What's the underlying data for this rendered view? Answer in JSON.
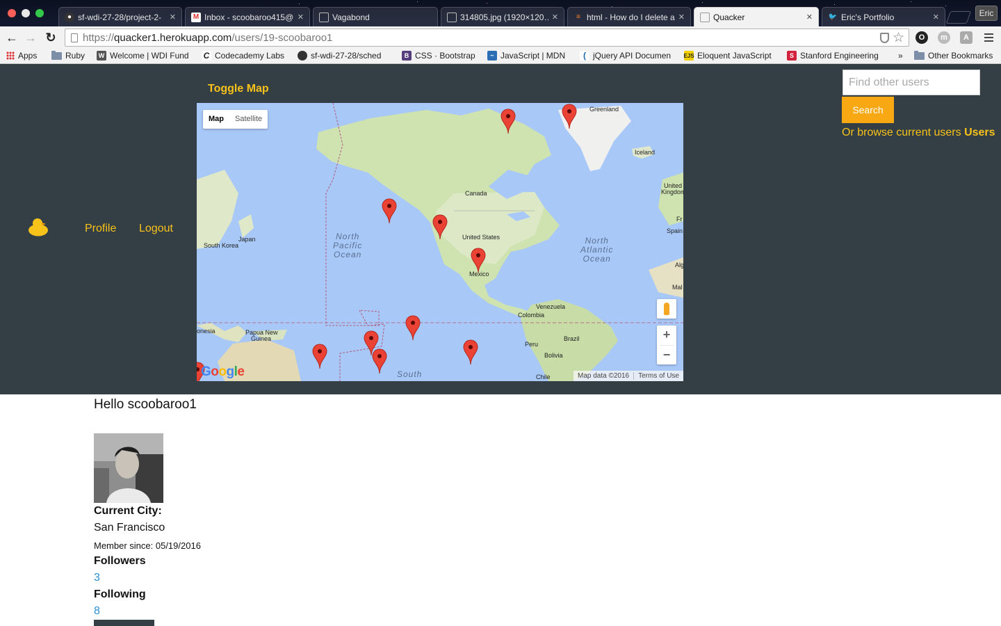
{
  "browser": {
    "window_user": "Eric",
    "tabs": [
      {
        "title": "sf-wdi-27-28/project-2-",
        "favicon": "github",
        "active": false
      },
      {
        "title": "Inbox - scoobaroo415@",
        "favicon": "gmail",
        "active": false
      },
      {
        "title": "Vagabond",
        "favicon": "page",
        "active": false
      },
      {
        "title": "314805.jpg (1920×120…",
        "favicon": "page",
        "active": false
      },
      {
        "title": "html - How do I delete ar",
        "favicon": "stackoverflow",
        "active": false
      },
      {
        "title": "Quacker",
        "favicon": "page",
        "active": true
      },
      {
        "title": "Eric's Portfolio",
        "favicon": "twitter",
        "active": false
      }
    ],
    "url_scheme": "https://",
    "url_host": "quacker1.herokuapp.com",
    "url_path": "/users/19-scoobaroo1",
    "bookmarks": [
      {
        "label": "Apps",
        "icon": "apps-grid"
      },
      {
        "label": "Ruby",
        "icon": "folder"
      },
      {
        "label": "Welcome | WDI Fund",
        "icon": "book"
      },
      {
        "label": "Codecademy Labs",
        "icon": "codecademy"
      },
      {
        "label": "sf-wdi-27-28/sched",
        "icon": "github"
      },
      {
        "label": "CSS · Bootstrap",
        "icon": "bootstrap"
      },
      {
        "label": "JavaScript | MDN",
        "icon": "mdn"
      },
      {
        "label": "jQuery API Documen",
        "icon": "jquery"
      },
      {
        "label": "Eloquent JavaScript",
        "icon": "ejs"
      },
      {
        "label": "Stanford Engineering",
        "icon": "stanford"
      },
      {
        "label": "»",
        "icon": "overflow"
      },
      {
        "label": "Other Bookmarks",
        "icon": "folder"
      }
    ]
  },
  "header": {
    "logo": "duck-icon",
    "nav": {
      "profile": "Profile",
      "logout": "Logout"
    },
    "toggle_map": "Toggle Map",
    "search": {
      "placeholder": "Find other users",
      "button": "Search"
    },
    "browse_prefix": "Or browse current users ",
    "browse_link": "Users"
  },
  "map": {
    "type_buttons": {
      "map": "Map",
      "satellite": "Satellite"
    },
    "labels": {
      "greenland": "Greenland",
      "iceland": "Iceland",
      "united_kingdom_1": "United",
      "united_kingdom_2": "Kingdom",
      "canada": "Canada",
      "united_states": "United States",
      "mexico": "Mexico",
      "japan": "Japan",
      "south_korea": "South Korea",
      "venezuela": "Venezuela",
      "colombia": "Colombia",
      "peru": "Peru",
      "brazil": "Brazil",
      "bolivia": "Bolivia",
      "chile": "Chile",
      "png_1": "Papua New",
      "png_2": "Guinea",
      "indonesia": "onesia",
      "spain": "Spain",
      "fr": "Fr",
      "alg": "Alg",
      "mal": "Mal"
    },
    "oceans": {
      "north_pacific": [
        "North",
        "Pacific",
        "Ocean"
      ],
      "north_atlantic": [
        "North",
        "Atlantic",
        "Ocean"
      ],
      "south": "South"
    },
    "zoom_in": "+",
    "zoom_out": "−",
    "map_data": "Map data ©2016",
    "terms": "Terms of Use",
    "google": "Google"
  },
  "profile": {
    "greeting": "Hello scoobaroo1",
    "current_city_label": "Current City:",
    "current_city": "San Francisco",
    "member_since": "Member since: 05/19/2016",
    "followers_label": "Followers",
    "followers_count": "3",
    "following_label": "Following",
    "following_count": "8"
  },
  "colors": {
    "header_bg": "#343e45",
    "accent_yellow": "#f7c21a",
    "search_btn": "#f8a812",
    "link_blue": "#2a8fd6"
  }
}
